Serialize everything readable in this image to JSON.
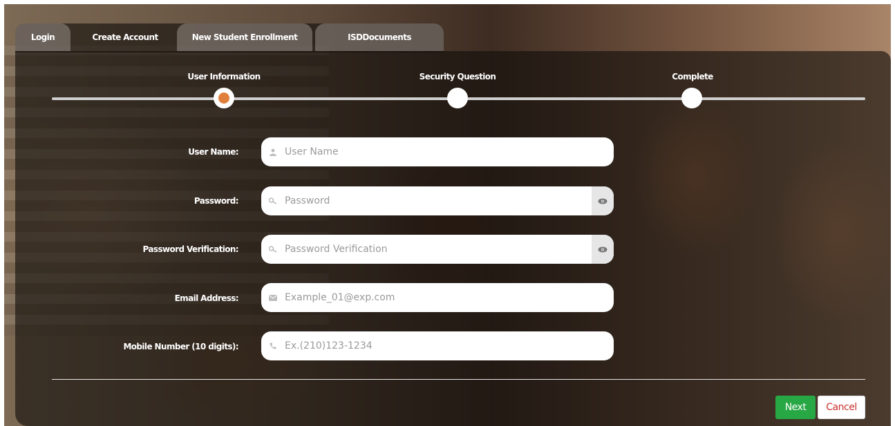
{
  "tabs": [
    {
      "label": "Login"
    },
    {
      "label": "Create Account"
    },
    {
      "label": "New Student Enrollment"
    },
    {
      "label": "ISDDocuments"
    }
  ],
  "active_tab": "Create Account",
  "steps": [
    {
      "label": "User Information",
      "state": "current"
    },
    {
      "label": "Security Question",
      "state": "pending"
    },
    {
      "label": "Complete",
      "state": "pending"
    }
  ],
  "form": {
    "username": {
      "label": "User Name:",
      "placeholder": "User Name",
      "icon": "user-icon"
    },
    "password": {
      "label": "Password:",
      "placeholder": "Password",
      "icon": "key-icon"
    },
    "password_verify": {
      "label": "Password Verification:",
      "placeholder": "Password Verification",
      "icon": "key-icon"
    },
    "email": {
      "label": "Email Address:",
      "placeholder": "Example_01@exp.com",
      "icon": "envelope-icon"
    },
    "mobile": {
      "label": "Mobile Number (10 digits):",
      "placeholder": "Ex.(210)123-1234",
      "icon": "phone-icon"
    }
  },
  "buttons": {
    "next": "Next",
    "cancel": "Cancel"
  },
  "colors": {
    "accent_step": "#e0803c",
    "next_bg": "#28a745",
    "cancel_text": "#c9302c"
  }
}
